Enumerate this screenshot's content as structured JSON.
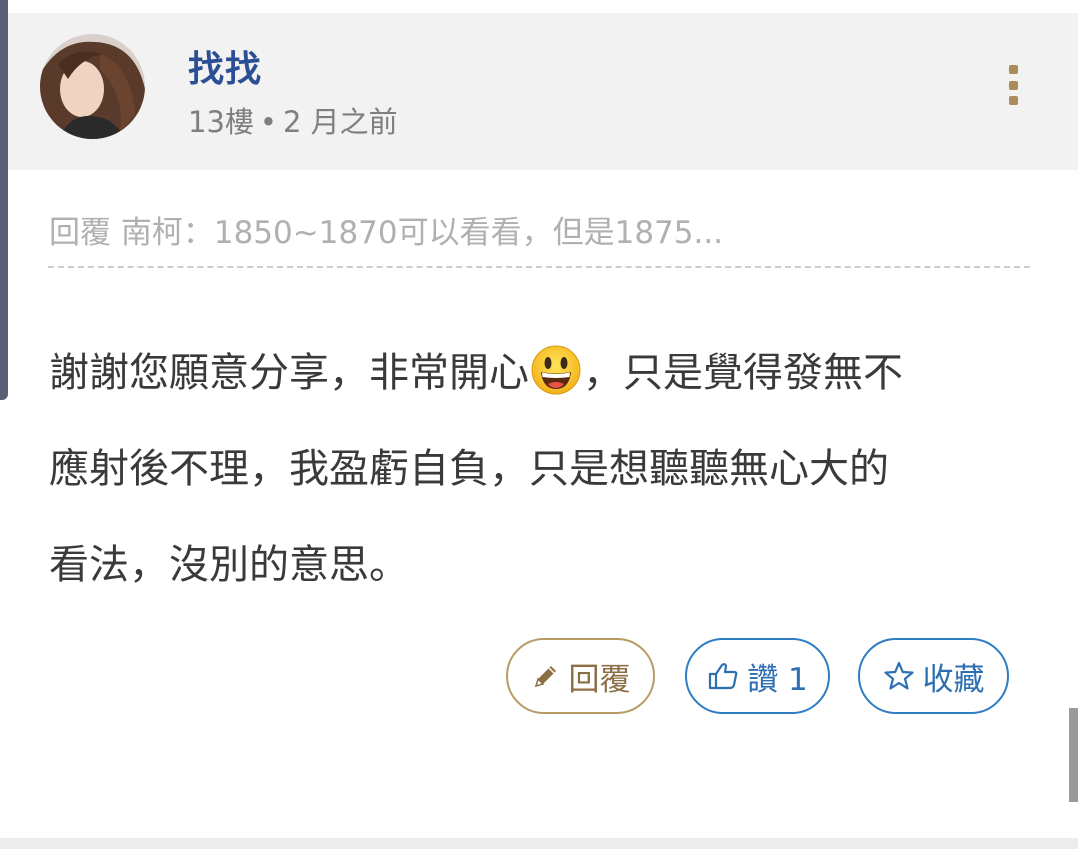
{
  "post": {
    "username": "找找",
    "floor": "13樓",
    "separator": "•",
    "time": "2 月之前",
    "quote": "回覆 南柯：1850~1870可以看看，但是1875...",
    "content_lines": [
      "謝謝您願意分享，非常開心",
      "，只是覺得發無不",
      "應射後不理，我盈虧自負，只是想聽聽無心大的",
      "看法，沒別的意思。"
    ]
  },
  "actions": {
    "reply_label": "回覆",
    "like_label": "讚 1",
    "favorite_label": "收藏"
  },
  "icons": {
    "more": "more-vertical-icon",
    "reply": "pencil-icon",
    "like": "thumbs-up-icon",
    "favorite": "star-icon",
    "emoji": "grinning-face-emoji"
  },
  "colors": {
    "username": "#2b4f94",
    "reply_accent": "#b89a66",
    "like_accent": "#2e7cc4",
    "header_bg": "#f2f2f2"
  }
}
